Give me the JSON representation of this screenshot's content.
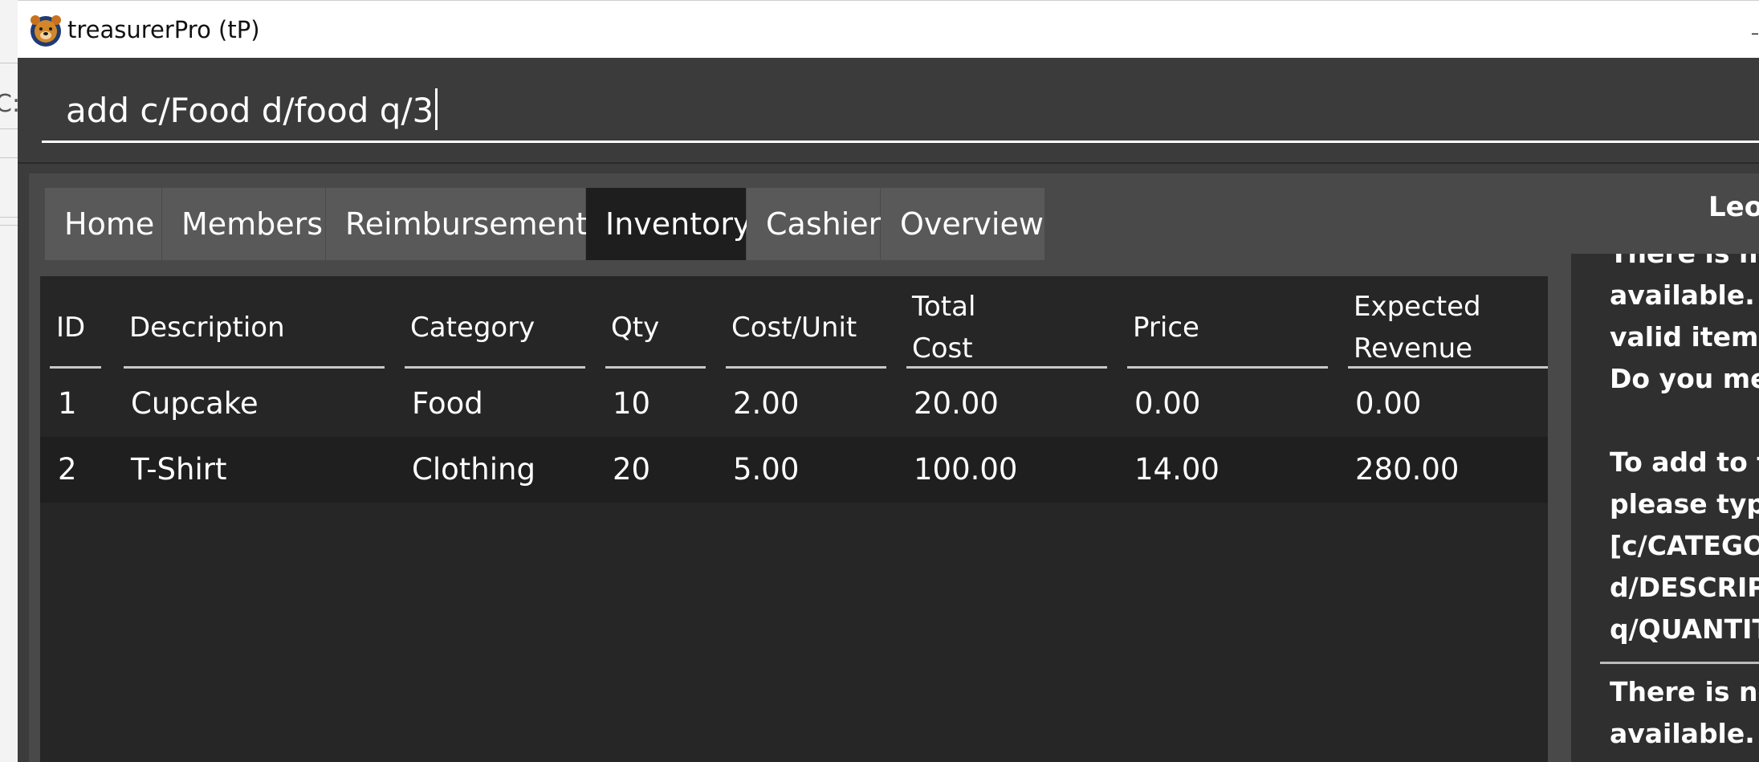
{
  "window": {
    "title": "treasurerPro (tP)",
    "logo_icon": "bear-face-icon",
    "control_glyph": "–"
  },
  "background_window": {
    "partial_text": "C:"
  },
  "command_box": {
    "value": "add c/Food d/food q/3"
  },
  "tabs": [
    {
      "label": "Home",
      "active": false
    },
    {
      "label": "Members",
      "active": false
    },
    {
      "label": "Reimbursements",
      "active": false
    },
    {
      "label": "Inventory",
      "active": true
    },
    {
      "label": "Cashier",
      "active": false
    },
    {
      "label": "Overview",
      "active": false
    }
  ],
  "inventory_table": {
    "headers": [
      "ID",
      "Description",
      "Category",
      "Qty",
      "Cost/Unit",
      "Total\nCost",
      "Price",
      "Expected\nRevenue"
    ],
    "rows": [
      [
        "1",
        "Cupcake",
        "Food",
        "10",
        "2.00",
        "20.00",
        "0.00",
        "0.00"
      ],
      [
        "2",
        "T-Shirt",
        "Clothing",
        "20",
        "5.00",
        "100.00",
        "14.00",
        "280.00"
      ]
    ]
  },
  "assistant": {
    "name": "Leo",
    "response_1": "There is no s\navailable. Ple\nvalid item.\nDo you mean\n\nTo add to th\nplease type '\n[c/CATEGOR\nd/DESCRIPTI\nq/QUANTITY",
    "response_2": "There is no s\navailable. Ple"
  },
  "colors": {
    "window_bg": "#3c3c3c",
    "panel_bg": "#494949",
    "table_bg": "#262626",
    "tab_bg": "#595959",
    "tab_active_bg": "#1e1e1e",
    "text": "#ffffff"
  }
}
